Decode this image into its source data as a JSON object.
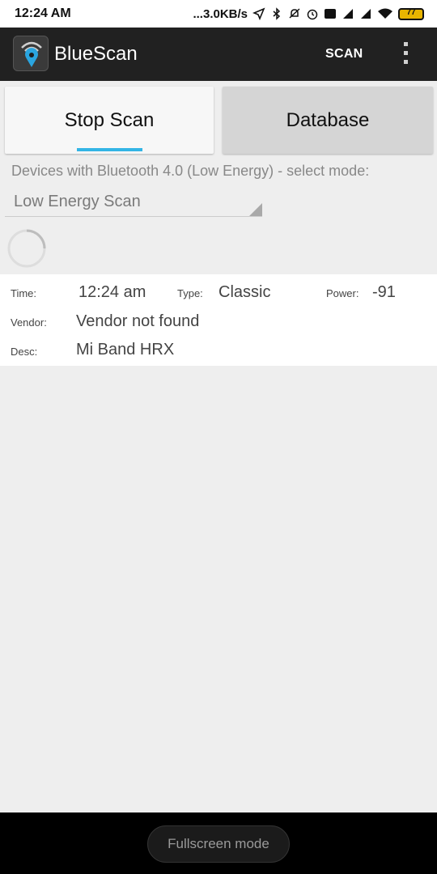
{
  "status_bar": {
    "time": "12:24 AM",
    "net_speed": "...3.0KB/s",
    "battery_level": "77",
    "icons": [
      "location-arrow-icon",
      "bluetooth-icon",
      "muted-bell-icon",
      "alarm-icon",
      "volte-icon",
      "signal-4g-icon",
      "signal-icon",
      "wifi-icon",
      "battery-icon"
    ]
  },
  "app_bar": {
    "title": "BlueScan",
    "scan_label": "SCAN",
    "overflow_icon": "more-vert-icon"
  },
  "tabs": {
    "stop_scan": "Stop Scan",
    "database": "Database",
    "active": "Stop Scan",
    "accent": "#33b5e5"
  },
  "mode": {
    "label": "Devices with Bluetooth 4.0 (Low Energy) - select mode:",
    "selected": "Low Energy Scan"
  },
  "device": {
    "time_label": "Time:",
    "time": "12:24 am",
    "type_label": "Type:",
    "type": "Classic",
    "power_label": "Power:",
    "power": "-91",
    "vendor_label": "Vendor:",
    "vendor": "Vendor not found",
    "desc_label": "Desc:",
    "desc": "Mi Band HRX"
  },
  "bottom": {
    "fullscreen_label": "Fullscreen mode"
  }
}
